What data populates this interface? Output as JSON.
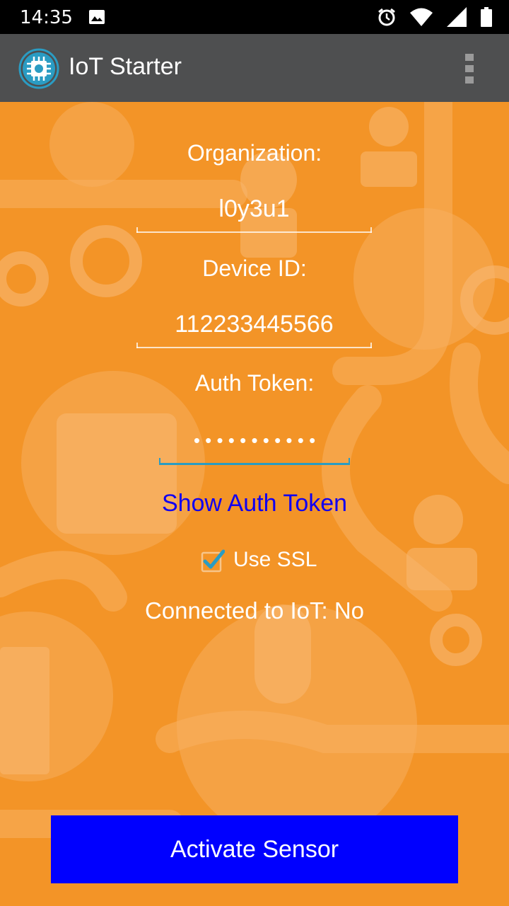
{
  "status_bar": {
    "time": "14:35"
  },
  "app_bar": {
    "title": "IoT Starter"
  },
  "form": {
    "organization_label": "Organization:",
    "organization_value": "l0y3u1",
    "device_id_label": "Device ID:",
    "device_id_value": "112233445566",
    "auth_token_label": "Auth Token:",
    "auth_token_masked": "• • • • • • • • • • •",
    "show_auth_token_link": "Show Auth Token",
    "use_ssl_label": "Use SSL",
    "use_ssl_checked": true,
    "connection_status": "Connected to IoT: No",
    "activate_button": "Activate Sensor"
  },
  "colors": {
    "background": "#F39427",
    "app_bar": "#4E4F50",
    "status_bar": "#000000",
    "link": "#1100F0",
    "button": "#0000FF",
    "focus_underline": "#2A9CC3",
    "check": "#2A9CC3"
  },
  "icons": {
    "logo": "chip-icon",
    "gallery": "image-icon",
    "alarm": "alarm-icon",
    "wifi": "wifi-icon",
    "signal": "signal-icon",
    "battery": "battery-icon",
    "overflow": "more-vert-icon"
  }
}
